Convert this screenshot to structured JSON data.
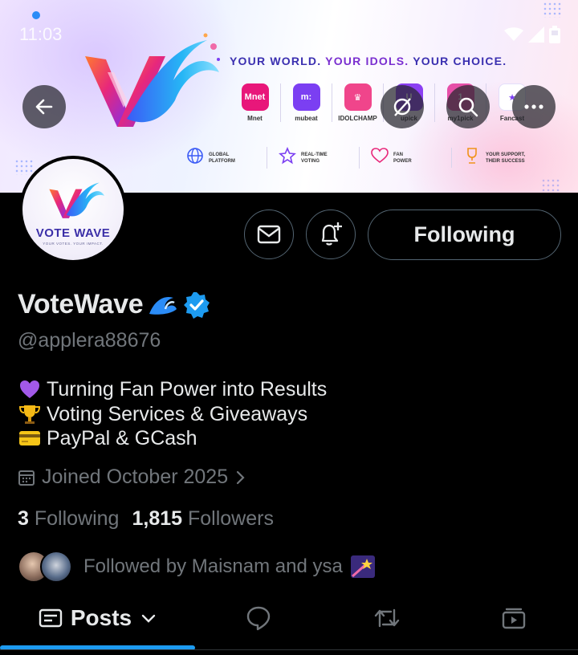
{
  "status_bar": {
    "time": "11:03"
  },
  "banner": {
    "tagline_parts": [
      "YOUR WORLD.",
      "YOUR IDOLS.",
      "YOUR CHOICE."
    ],
    "platforms": [
      {
        "name": "Mnet",
        "icon": "mnet-icon",
        "glyph": "Mnet",
        "color": "#e8177a"
      },
      {
        "name": "mubeat",
        "icon": "mubeat-icon",
        "glyph": "m:",
        "color": "#7b3ff2"
      },
      {
        "name": "IDOLCHAMP",
        "icon": "idolchamp-icon",
        "glyph": "♛",
        "color": "#f0458b"
      },
      {
        "name": "upick",
        "icon": "upick-icon",
        "glyph": "U",
        "color": "#8b3ff2"
      },
      {
        "name": "my1pick",
        "icon": "my1pick-icon",
        "glyph": "1",
        "color": "#e64fa8"
      },
      {
        "name": "Fancast",
        "icon": "fancast-icon",
        "glyph": "★",
        "color": "#ffffff"
      }
    ],
    "features": [
      {
        "label": "GLOBAL\nPLATFORM",
        "icon": "globe-icon"
      },
      {
        "label": "REAL-TIME\nVOTING",
        "icon": "star-icon"
      },
      {
        "label": "FAN\nPOWER",
        "icon": "heart-icon"
      },
      {
        "label": "YOUR SUPPORT,\nTHEIR SUCCESS",
        "icon": "trophy-icon"
      }
    ]
  },
  "avatar": {
    "title": "VOTE WAVE",
    "subtitle": "YOUR VOTES. YOUR IMPACT."
  },
  "actions": {
    "follow_label": "Following"
  },
  "profile": {
    "name": "VoteWave",
    "handle": "@applera88676",
    "bio": [
      {
        "emoji": "purple-heart-icon",
        "text": "Turning Fan Power into Results"
      },
      {
        "emoji": "trophy-icon",
        "text": "Voting Services & Giveaways"
      },
      {
        "emoji": "credit-card-icon",
        "text": "PayPal & GCash"
      }
    ],
    "joined": "Joined October 2025",
    "following_count": "3",
    "following_label": "Following",
    "followers_count": "1,815",
    "followers_label": "Followers",
    "followed_by": "Followed by Maisnam and ysa"
  },
  "tabs": {
    "posts_label": "Posts"
  },
  "colors": {
    "accent": "#1d9bf0",
    "verified": "#1d9bf0",
    "muted": "#71767b",
    "text": "#e7e9ea"
  }
}
